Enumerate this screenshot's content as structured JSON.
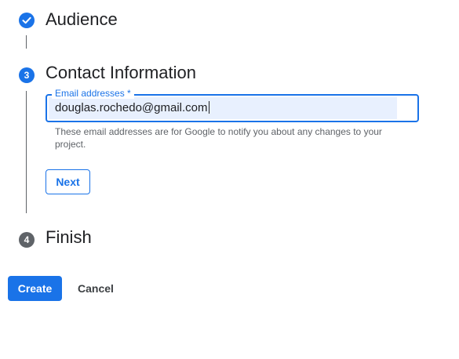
{
  "stepper": {
    "steps": [
      {
        "title": "Audience",
        "status": "completed",
        "icon": "check-icon"
      },
      {
        "number": "3",
        "title": "Contact Information",
        "status": "active"
      },
      {
        "number": "4",
        "title": "Finish",
        "status": "pending"
      }
    ]
  },
  "contact": {
    "email_label": "Email addresses *",
    "email_value": "douglas.rochedo@gmail.com",
    "helper_text": "These email addresses are for Google to notify you about any changes to your project.",
    "next_label": "Next"
  },
  "footer": {
    "create_label": "Create",
    "cancel_label": "Cancel"
  },
  "colors": {
    "accent": "#1a73e8",
    "pending_step": "#5f6368",
    "field_fill": "#e8f0fe"
  }
}
